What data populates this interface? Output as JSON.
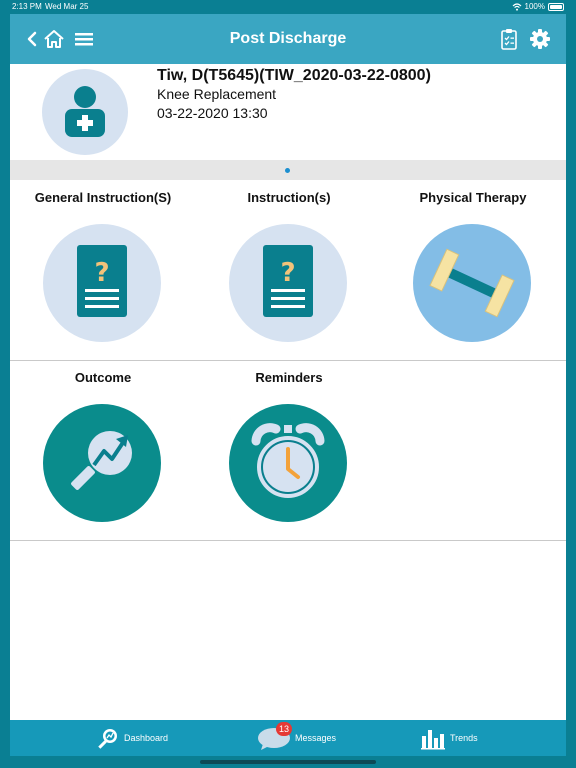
{
  "status_bar": {
    "time": "2:13 PM",
    "date": "Wed Mar 25",
    "battery": "100%"
  },
  "header": {
    "title": "Post Discharge"
  },
  "patient": {
    "name": "Tiw, D(T5645)(TIW_2020-03-22-0800)",
    "procedure": "Knee Replacement",
    "datetime": "03-22-2020 13:30"
  },
  "tiles": [
    {
      "label": "General Instruction(S)",
      "icon": "document-question-icon"
    },
    {
      "label": "Instruction(s)",
      "icon": "document-question-icon"
    },
    {
      "label": "Physical Therapy",
      "icon": "dumbbell-icon"
    },
    {
      "label": "Outcome",
      "icon": "magnifier-trend-icon"
    },
    {
      "label": "Reminders",
      "icon": "alarm-clock-icon"
    }
  ],
  "tabbar": {
    "dashboard": "Dashboard",
    "messages": "Messages",
    "messages_badge": "13",
    "trends": "Trends"
  },
  "colors": {
    "header": "#3aa6c2",
    "tabbar": "#1699b9",
    "teal": "#0a8c8c",
    "light_circle": "#d6e2f1",
    "pager_dot": "#1c8fd0",
    "badge": "#e53935"
  }
}
